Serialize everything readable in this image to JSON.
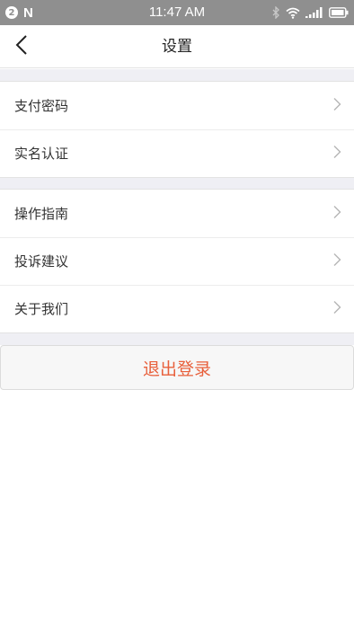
{
  "status_bar": {
    "notification_count": "2",
    "n_logo": "N",
    "time": "11:47 AM",
    "icons": [
      "notification-badge-icon",
      "n-logo-icon",
      "bluetooth-icon",
      "wifi-icon",
      "signal-icon",
      "battery-icon"
    ]
  },
  "header": {
    "back_icon": "chevron-left-icon",
    "title": "设置"
  },
  "groups": [
    {
      "items": [
        {
          "label": "支付密码"
        },
        {
          "label": "实名认证"
        }
      ]
    },
    {
      "items": [
        {
          "label": "操作指南"
        },
        {
          "label": "投诉建议"
        },
        {
          "label": "关于我们"
        }
      ]
    }
  ],
  "logout": {
    "label": "退出登录"
  },
  "colors": {
    "status_bar_bg": "#8f8f8f",
    "section_gap_bg": "#efeff4",
    "logout_text": "#e8603c",
    "logout_bg": "#f7f7f7"
  }
}
